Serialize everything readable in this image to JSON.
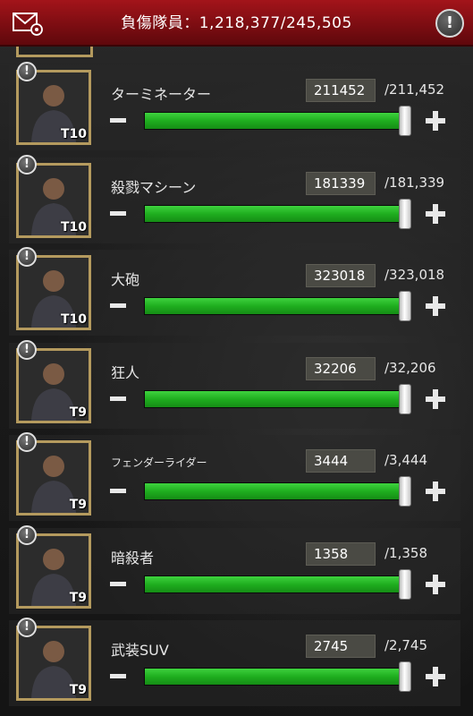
{
  "header": {
    "title_label": "負傷隊員：",
    "title_value": "1,218,377/245,505",
    "mail_icon": "mail-settings-icon",
    "info_icon": "info-icon",
    "info_glyph": "!"
  },
  "units": [
    {
      "name": "ターミネーター",
      "tier": "T10",
      "count": "211452",
      "max": "/211,452",
      "fill": 1.0
    },
    {
      "name": "殺戮マシーン",
      "tier": "T10",
      "count": "181339",
      "max": "/181,339",
      "fill": 1.0
    },
    {
      "name": "大砲",
      "tier": "T10",
      "count": "323018",
      "max": "/323,018",
      "fill": 1.0
    },
    {
      "name": "狂人",
      "tier": "T9",
      "count": "32206",
      "max": "/32,206",
      "fill": 1.0
    },
    {
      "name": "フェンダーライダー",
      "tier": "T9",
      "count": "3444",
      "max": "/3,444",
      "fill": 1.0
    },
    {
      "name": "暗殺者",
      "tier": "T9",
      "count": "1358",
      "max": "/1,358",
      "fill": 1.0
    },
    {
      "name": "武装SUV",
      "tier": "T9",
      "count": "2745",
      "max": "/2,745",
      "fill": 1.0
    }
  ],
  "alert_glyph": "!",
  "colors": {
    "header_red": "#8e1016",
    "bar_green": "#1fae1f",
    "portrait_border": "#b49a5e"
  }
}
